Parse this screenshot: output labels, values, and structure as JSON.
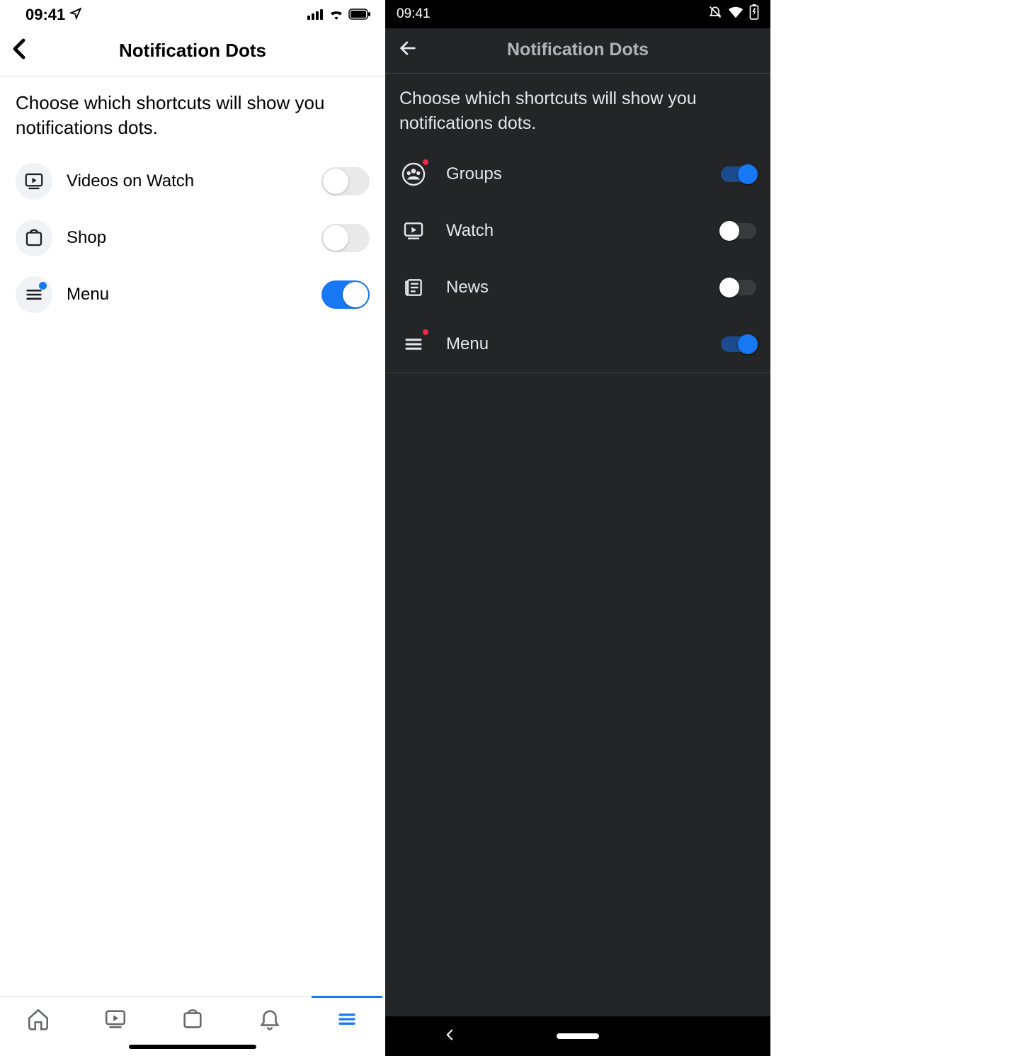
{
  "ios": {
    "status": {
      "time": "09:41"
    },
    "header": {
      "title": "Notification Dots"
    },
    "description": "Choose which shortcuts will show you notifications dots.",
    "rows": [
      {
        "label": "Videos on Watch",
        "on": false,
        "dot": false,
        "icon": "watch"
      },
      {
        "label": "Shop",
        "on": false,
        "dot": false,
        "icon": "shop"
      },
      {
        "label": "Menu",
        "on": true,
        "dot": true,
        "icon": "menu"
      }
    ]
  },
  "android": {
    "status": {
      "time": "09:41"
    },
    "header": {
      "title": "Notification Dots"
    },
    "description": "Choose which shortcuts will show you notifications dots.",
    "rows": [
      {
        "label": "Groups",
        "on": true,
        "dot": true,
        "icon": "groups"
      },
      {
        "label": "Watch",
        "on": false,
        "dot": false,
        "icon": "watch"
      },
      {
        "label": "News",
        "on": false,
        "dot": false,
        "icon": "news"
      },
      {
        "label": "Menu",
        "on": true,
        "dot": true,
        "icon": "menu"
      }
    ]
  }
}
